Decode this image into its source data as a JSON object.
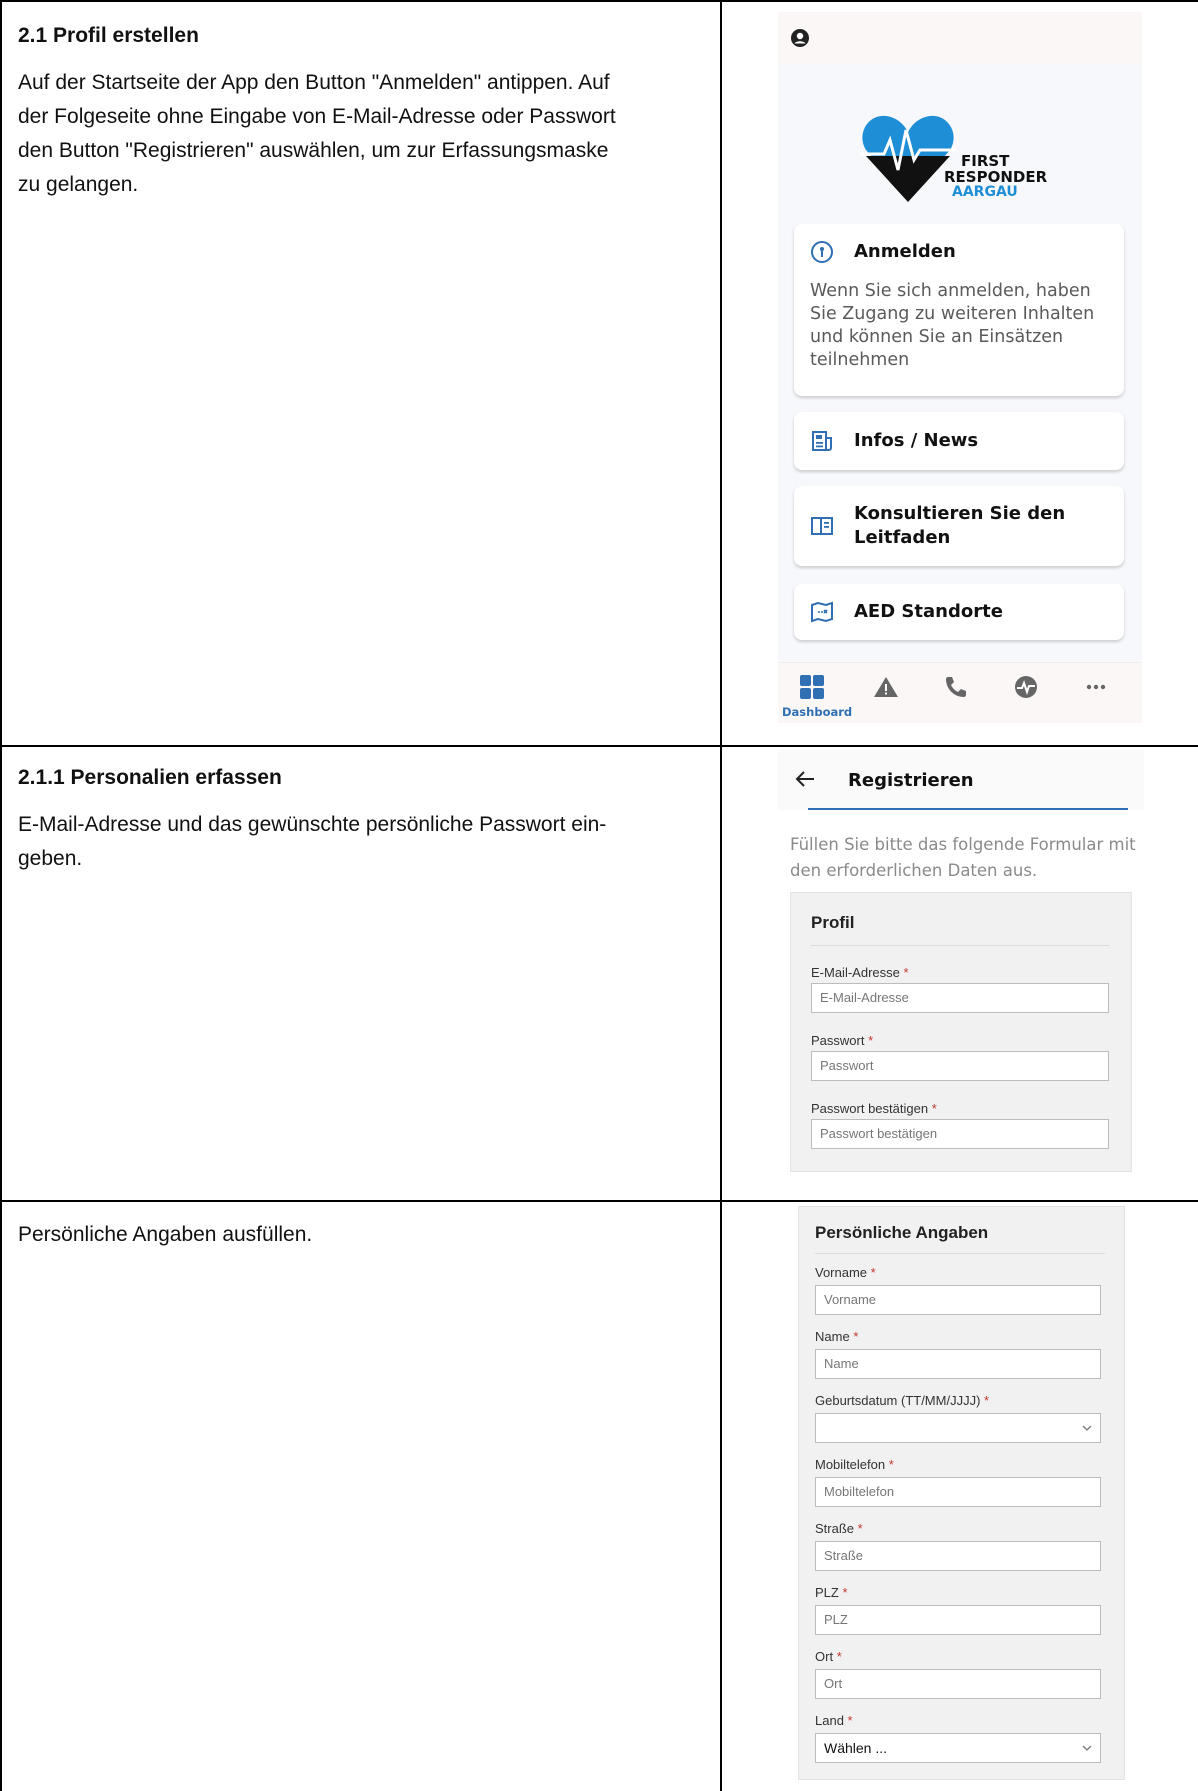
{
  "section1": {
    "heading": "2.1 Profil erstellen",
    "lines": [
      "Auf der Startseite der App den Button \"Anmelden\" antippen. Auf",
      "der Folgeseite ohne Eingabe von E-Mail-Adresse oder Passwort",
      "den Button \"Registrieren\" auswählen, um zur Erfassungsmaske",
      "zu gelangen."
    ]
  },
  "section2": {
    "heading": "2.1.1 Personalien erfassen",
    "lines": [
      "E-Mail-Adresse und das gewünschte persönliche Passwort ein-",
      "geben."
    ]
  },
  "section3": {
    "lines": [
      "Persönliche Angaben ausfüllen."
    ]
  },
  "app_home": {
    "logo_text": [
      "FIRST",
      "RESPONDER",
      "AARGAU"
    ],
    "cards": [
      {
        "title": "Anmelden",
        "icon": "key-circle-icon",
        "desc": "Wenn Sie sich anmelden, haben Sie Zugang zu weiteren Inhalten und können Sie an Einsätzen teilnehmen"
      },
      {
        "title": "Infos / News",
        "icon": "news-icon"
      },
      {
        "title": "Konsultieren Sie den Leitfaden",
        "icon": "book-icon"
      },
      {
        "title": "AED Standorte",
        "icon": "map-icon"
      }
    ],
    "nav": {
      "active_label": "Dashboard",
      "items": [
        "dashboard-icon",
        "warning-icon",
        "phone-icon",
        "pulse-icon",
        "more-icon"
      ]
    },
    "colors": {
      "accent": "#2f6fb2",
      "logo_blue": "#1e8fd6"
    }
  },
  "register": {
    "title": "Registrieren",
    "intro": "Füllen Sie bitte das folgende Formular mit den erforderlichen Daten aus.",
    "profile": {
      "title": "Profil",
      "fields": [
        {
          "label": "E-Mail-Adresse",
          "placeholder": "E-Mail-Adresse"
        },
        {
          "label": "Passwort",
          "placeholder": "Passwort"
        },
        {
          "label": "Passwort bestätigen",
          "placeholder": "Passwort bestätigen"
        }
      ]
    }
  },
  "personal": {
    "title": "Persönliche Angaben",
    "fields": [
      {
        "label": "Vorname",
        "placeholder": "Vorname"
      },
      {
        "label": "Name",
        "placeholder": "Name"
      },
      {
        "label": "Geburtsdatum (TT/MM/JJJJ)",
        "placeholder": ""
      },
      {
        "label": "Mobiltelefon",
        "placeholder": "Mobiltelefon"
      },
      {
        "label": "Straße",
        "placeholder": "Straße"
      },
      {
        "label": "PLZ",
        "placeholder": "PLZ"
      },
      {
        "label": "Ort",
        "placeholder": "Ort"
      },
      {
        "label": "Land",
        "placeholder": "Wählen ..."
      }
    ],
    "required_mark": "*"
  }
}
